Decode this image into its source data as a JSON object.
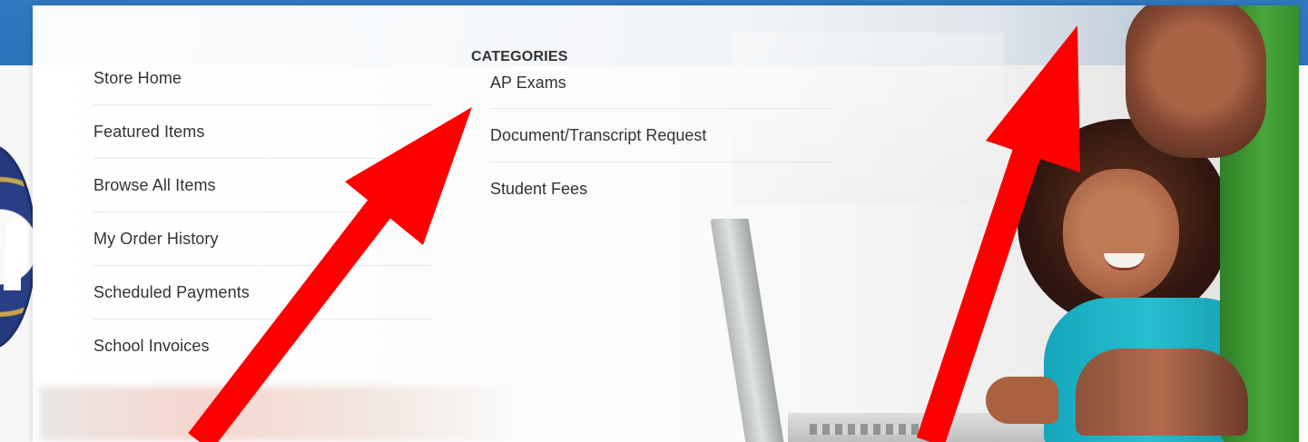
{
  "menu": {
    "items": [
      {
        "label": "Store Home"
      },
      {
        "label": "Featured Items"
      },
      {
        "label": "Browse All Items"
      },
      {
        "label": "My Order History"
      },
      {
        "label": "Scheduled Payments"
      },
      {
        "label": "School Invoices"
      }
    ]
  },
  "categories": {
    "title": "CATEGORIES",
    "items": [
      {
        "label": "AP Exams"
      },
      {
        "label": "Document/Transcript Request"
      },
      {
        "label": "Student Fees"
      }
    ]
  },
  "colors": {
    "header_blue": "#2f79bf",
    "text": "#333333",
    "annotation_red": "#ff0000"
  },
  "icons": {
    "school_logo": "school-logo-icon"
  }
}
